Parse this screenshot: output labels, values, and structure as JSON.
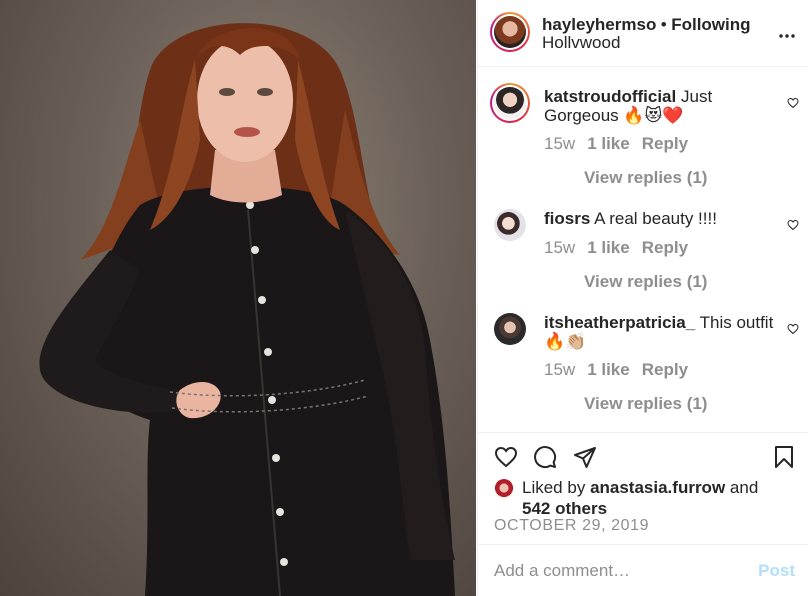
{
  "post": {
    "photo_alt": "",
    "author": {
      "username": "hayleyhermso",
      "separator": "•",
      "follow_status": "Following",
      "location": "Hollvwood"
    },
    "more_label": "•••"
  },
  "comments": [
    {
      "username": "katstroudofficial",
      "text": "Just Gorgeous 🔥😻❤️",
      "age": "15w",
      "likes": "1 like",
      "reply": "Reply",
      "view_replies": "View replies (1)"
    },
    {
      "username": "fiosrs",
      "text": "A real beauty !!!!",
      "age": "15w",
      "likes": "1 like",
      "reply": "Reply",
      "view_replies": "View replies (1)"
    },
    {
      "username": "itsheatherpatricia_",
      "text": "This outfit 🔥👏🏼",
      "age": "15w",
      "likes": "1 like",
      "reply": "Reply",
      "view_replies": "View replies (1)"
    }
  ],
  "actions": {
    "icons": [
      "heart-icon",
      "comment-icon",
      "share-icon",
      "bookmark-icon"
    ],
    "liked_by_prefix": "Liked by",
    "liked_by_user": "anastasia.furrow",
    "liked_by_and": "and",
    "liked_by_others": "542 others",
    "date": "OCTOBER 29, 2019"
  },
  "composer": {
    "placeholder": "Add a comment…",
    "value": "",
    "post_label": "Post"
  },
  "colors": {
    "accent": "#0095f6",
    "post_disabled": "#b2dffc",
    "muted": "#8e8e8e",
    "text": "#262626"
  }
}
